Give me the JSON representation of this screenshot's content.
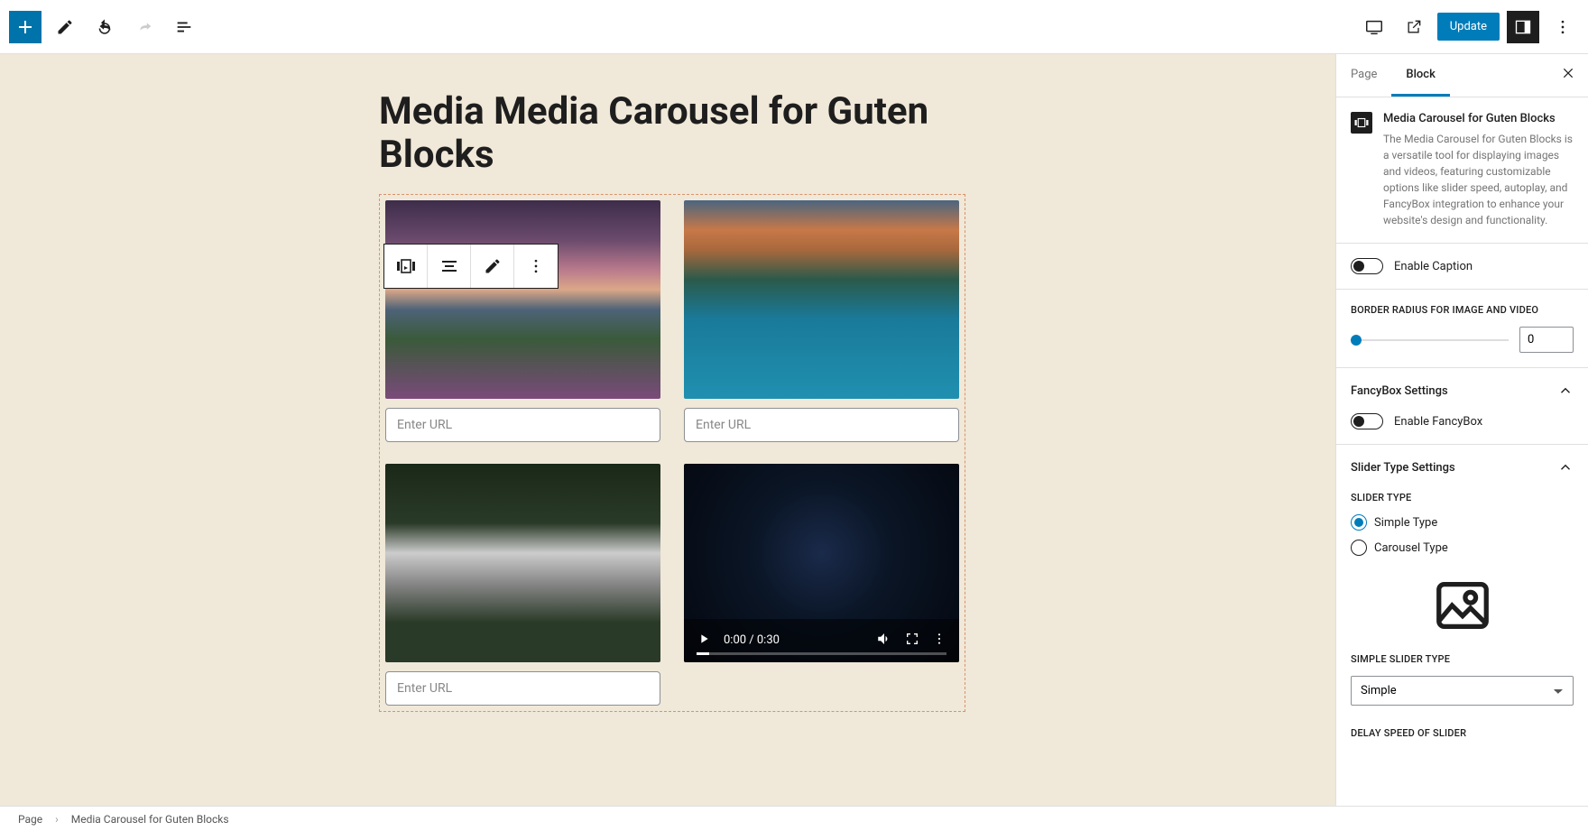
{
  "toolbar": {
    "update_label": "Update"
  },
  "page_title": "Media Media Carousel for Guten Blocks",
  "carousel": {
    "url_placeholder": "Enter URL",
    "video_time": "0:00 / 0:30"
  },
  "sidebar": {
    "tabs": {
      "page": "Page",
      "block": "Block"
    },
    "block_name": "Media Carousel for Guten Blocks",
    "block_desc": "The Media Carousel for Guten Blocks is a versatile tool for displaying images and videos, featuring customizable options like slider speed, autoplay, and FancyBox integration to enhance your website's design and functionality.",
    "enable_caption_label": "Enable Caption",
    "border_radius_label": "BORDER RADIUS FOR IMAGE AND VIDEO",
    "border_radius_value": "0",
    "fancybox_panel": "FancyBox Settings",
    "enable_fancybox_label": "Enable FancyBox",
    "slider_type_panel": "Slider Type Settings",
    "slider_type_label": "SLIDER TYPE",
    "slider_type_simple": "Simple Type",
    "slider_type_carousel": "Carousel Type",
    "simple_slider_type_label": "SIMPLE SLIDER TYPE",
    "simple_slider_type_value": "Simple",
    "delay_speed_label": "DELAY SPEED OF SLIDER"
  },
  "breadcrumb": {
    "root": "Page",
    "current": "Media Carousel for Guten Blocks"
  }
}
